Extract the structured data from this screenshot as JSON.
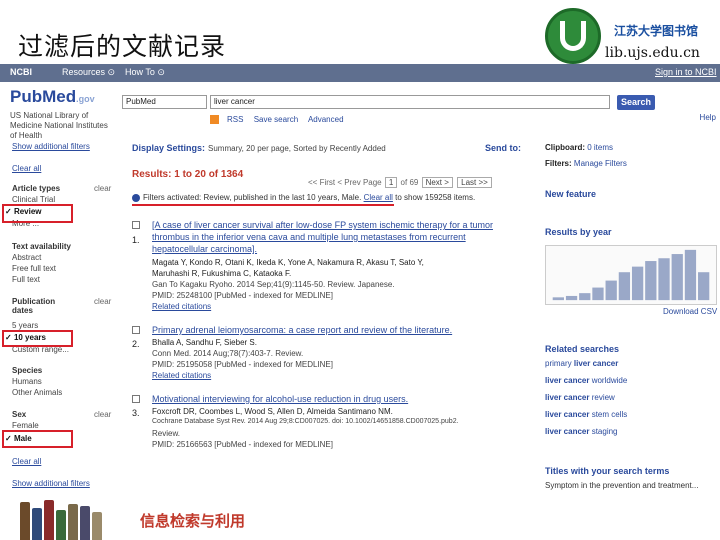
{
  "slide": {
    "title": "过滤后的文献记录",
    "library_name": "江苏大学图书馆",
    "library_url": "lib.ujs.edu.cn",
    "footer": "信息检索与利用"
  },
  "ncbi": {
    "logo": "NCBI",
    "resources": "Resources ⊙",
    "howto": "How To ⊙",
    "signin": "Sign in to NCBI"
  },
  "pubmed": {
    "logo": "PubMed",
    "logo_suffix": ".gov",
    "org": "US National Library of Medicine National Institutes of Health",
    "db_value": "PubMed",
    "search_value": "liver cancer",
    "search_button": "Search",
    "rss": "RSS",
    "save_search": "Save search",
    "advanced": "Advanced",
    "help": "Help"
  },
  "sidebar": {
    "show_filters": "Show additional filters",
    "clear_all": "Clear all",
    "article_types": "Article types",
    "clear": "clear",
    "clinical_trial": "Clinical Trial",
    "review": "Review",
    "more": "More ...",
    "text_availability": "Text availability",
    "abstract": "Abstract",
    "free_full_text": "Free full text",
    "full_text": "Full text",
    "pub_dates": "Publication dates",
    "five_years": "5 years",
    "ten_years": "10 years",
    "custom_range": "Custom range...",
    "species": "Species",
    "humans": "Humans",
    "other_animals": "Other Animals",
    "sex": "Sex",
    "female": "Female",
    "male": "Male",
    "clear_all2": "Clear all",
    "show_filters2": "Show additional filters"
  },
  "main": {
    "display_settings": "Display Settings:",
    "display_value": "Summary, 20 per page, Sorted by Recently Added",
    "send_to": "Send to:",
    "results": "Results: 1 to 20 of 1364",
    "first": "<< First",
    "prev": "< Prev",
    "page_label": "Page",
    "page_value": "1",
    "of_pages": "of 69",
    "next": "Next >",
    "last": "Last >>",
    "notice": "Filters activated: Review, published in the last 10 years, Male.",
    "clear_all": "Clear all",
    "notice_tail": "to show 159258 items.",
    "items": [
      {
        "num": "1.",
        "title_l1": "[A case of liver cancer survival after low-dose FP system ischemic therapy for a tumor",
        "title_l2": "thrombus in the inferior vena cava and multiple lung metastases from recurrent",
        "title_l3": "hepatocellular carcinoma].",
        "authors_l1": "Magata Y, Kondo R, Otani K, Ikeda K, Yone A, Nakamura R, Akasu T, Sato Y,",
        "authors_l2": "Maruhashi R, Fukushima C, Kataoka F.",
        "meta_l1": "Gan To Kagaku Ryoho. 2014 Sep;41(9):1145-50. Review. Japanese.",
        "meta_l2": "PMID: 25248100 [PubMed - indexed for MEDLINE]",
        "related": "Related citations"
      },
      {
        "num": "2.",
        "title_l1": "Primary adrenal leiomyosarcoma: a case report and review of the literature.",
        "authors_l1": "Bhalla A, Sandhu F, Sieber S.",
        "meta_l1": "Conn Med. 2014 Aug;78(7):403-7. Review.",
        "meta_l2": "PMID: 25195058 [PubMed - indexed for MEDLINE]",
        "related": "Related citations"
      },
      {
        "num": "3.",
        "title_l1": "Motivational interviewing for alcohol-use reduction in drug users.",
        "authors_l1": "Foxcroft DR, Coombes L, Wood S, Allen D, Almeida Santimano NM.",
        "meta_l1": "Cochrane Database Syst Rev. 2014 Aug 29;8:CD007025. doi: 10.1002/14651858.CD007025.pub2.",
        "meta_l2": "Review.",
        "meta_l3": "PMID: 25166563 [PubMed - indexed for MEDLINE]"
      }
    ]
  },
  "right": {
    "clipboard": "Clipboard:",
    "clipboard_link": "0 items",
    "filters": "Filters:",
    "manage_filters": "Manage Filters",
    "new_feature": "New feature",
    "results_by_year": "Results by year",
    "download_csv": "Download CSV",
    "related_searches": "Related searches",
    "rs": [
      {
        "pre": "primary ",
        "bold": "liver cancer",
        "post": ""
      },
      {
        "pre": "",
        "bold": "liver cancer",
        "post": " worldwide"
      },
      {
        "pre": "",
        "bold": "liver cancer",
        "post": " review"
      },
      {
        "pre": "",
        "bold": "liver cancer",
        "post": " stem cells"
      },
      {
        "pre": "",
        "bold": "liver cancer",
        "post": " staging"
      }
    ],
    "titles_with_terms": "Titles with your search terms",
    "titles_item": "Symptom in the prevention and treatment..."
  },
  "chart_data": {
    "type": "bar",
    "categories": [],
    "values": [
      2,
      3,
      5,
      9,
      14,
      20,
      24,
      28,
      30,
      33,
      36,
      20
    ]
  }
}
